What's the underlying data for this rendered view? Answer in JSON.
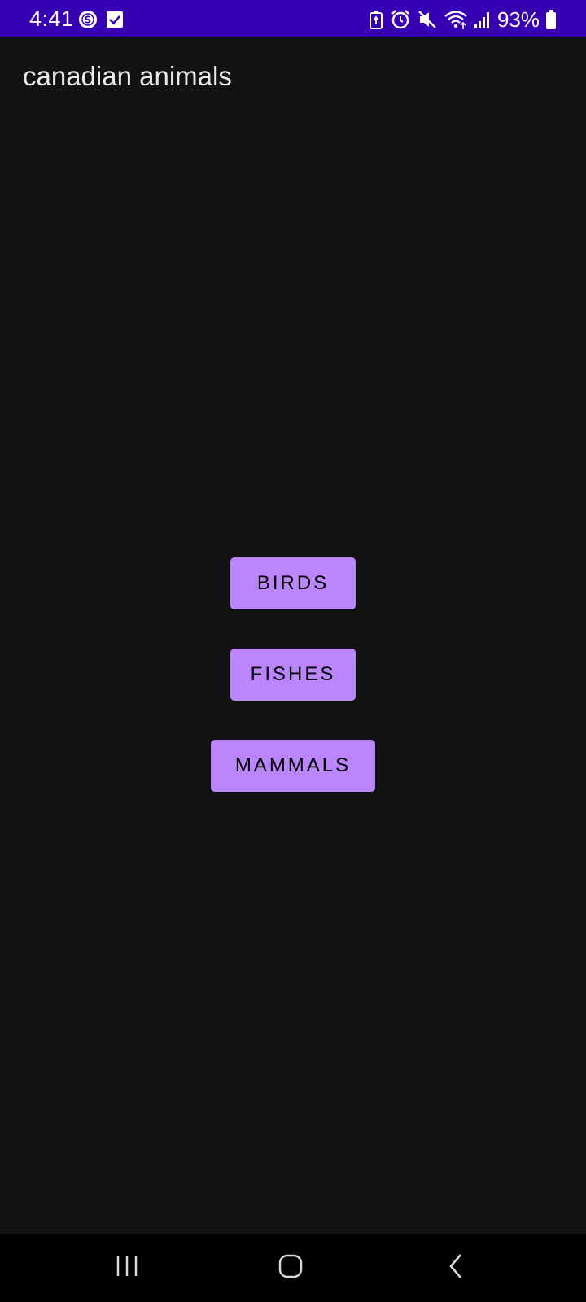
{
  "status_bar": {
    "time": "4:41",
    "battery_percent": "93%",
    "background_color": "#3700b3",
    "left_icons": [
      "s-circle-icon",
      "checkbox-icon"
    ],
    "right_icons": [
      "battery-saver-icon",
      "alarm-icon",
      "mute-icon",
      "wifi-icon",
      "signal-icon",
      "battery-icon"
    ]
  },
  "app_bar": {
    "title": "canadian animals"
  },
  "buttons": {
    "birds": "BIRDS",
    "fishes": "FISHES",
    "mammals": "MAMMALS",
    "color": "#bb86fc"
  },
  "nav_bar": {
    "items": [
      "recents-icon",
      "home-icon",
      "back-icon"
    ]
  },
  "colors": {
    "background": "#121212",
    "accent": "#bb86fc",
    "status_bar": "#3700b3"
  }
}
